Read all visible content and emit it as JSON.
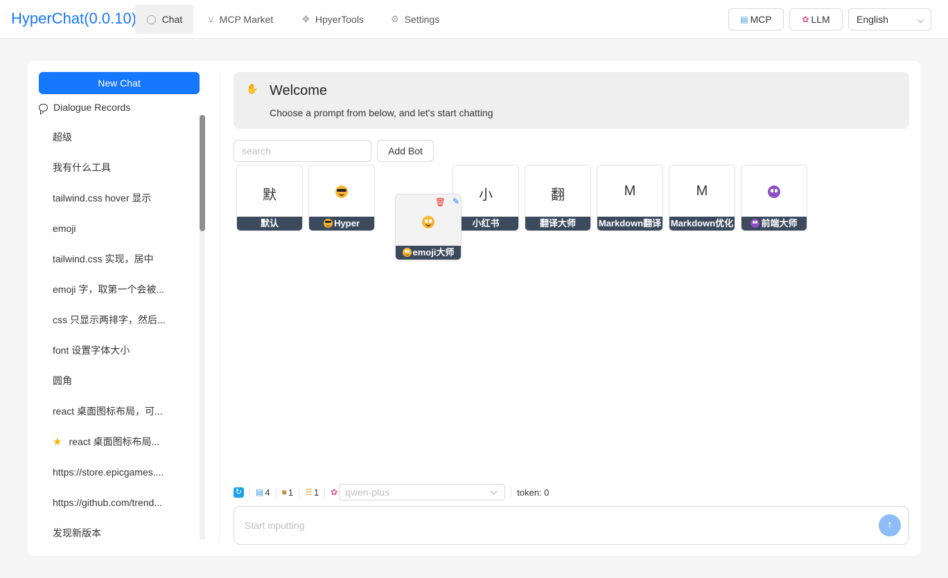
{
  "header": {
    "title": "HyperChat(0.0.10)",
    "nav": [
      {
        "label": "Chat",
        "icon": "chat-bubble-icon",
        "active": true
      },
      {
        "label": "MCP Market",
        "icon": "cart-icon",
        "active": false
      },
      {
        "label": "HpyerTools",
        "icon": "wrench-icon",
        "active": false
      },
      {
        "label": "Settings",
        "icon": "gear-icon",
        "active": false
      }
    ],
    "mcp_button": "MCP",
    "llm_button": "LLM",
    "language": "English"
  },
  "sidebar": {
    "new_chat": "New Chat",
    "records_title": "Dialogue Records",
    "records": [
      {
        "label": "超级"
      },
      {
        "label": "我有什么工具"
      },
      {
        "label": "tailwind.css hover 显示"
      },
      {
        "label": "emoji"
      },
      {
        "label": "tailwind.css 实现，居中"
      },
      {
        "label": "emoji 字，取第一个会被..."
      },
      {
        "label": "css 只显示两排字，然后..."
      },
      {
        "label": "font 设置字体大小"
      },
      {
        "label": "圆角"
      },
      {
        "label": "react 桌面图标布局，可..."
      },
      {
        "label": "react 桌面图标布局...",
        "starred": true
      },
      {
        "label": "https://store.epicgames...."
      },
      {
        "label": "https://github.com/trend..."
      },
      {
        "label": "发现新版本"
      }
    ]
  },
  "welcome": {
    "title": "Welcome",
    "subtitle": "Choose a prompt from below, and let's start chatting"
  },
  "bots": {
    "search_placeholder": "search",
    "add_label": "Add Bot",
    "items": [
      {
        "avatar": "默",
        "label": "默认"
      },
      {
        "avatar": "sunglasses-emoji",
        "label": "Hyper"
      },
      {
        "avatar": "小",
        "label": "小红书"
      },
      {
        "avatar": "翻",
        "label": "翻译大师"
      },
      {
        "avatar": "M",
        "label": "Markdown翻译"
      },
      {
        "avatar": "M",
        "label": "Markdown优化"
      },
      {
        "avatar": "devil-emoji",
        "label": "前端大师"
      }
    ],
    "dragging": {
      "avatar": "grinning-emoji",
      "label": "emoji大师"
    }
  },
  "toolbar": {
    "mcp_count": "4",
    "tool_count": "1",
    "prompt_count": "1",
    "model_placeholder": "qwen-plus",
    "token": "token: 0"
  },
  "input": {
    "placeholder": "Start inputting"
  },
  "colors": {
    "accent": "#1677ff",
    "tile_label_bg": "#3c4a5d",
    "send_button": "#8ebcf7"
  }
}
